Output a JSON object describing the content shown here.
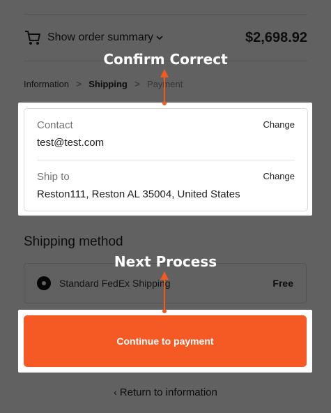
{
  "header": {
    "summary_label": "Show order summary",
    "total": "$2,698.92",
    "icons": {
      "cart": "cart-icon",
      "chevron": "chevron-down-icon"
    }
  },
  "breadcrumb": {
    "information": "Information",
    "shipping": "Shipping",
    "payment": "Payment",
    "separator": ">"
  },
  "review": {
    "contact_label": "Contact",
    "contact_value": "test@test.com",
    "contact_change": "Change",
    "shipto_label": "Ship to",
    "shipto_value": "Reston111, Reston AL 35004, United States",
    "shipto_change": "Change"
  },
  "shipping_method": {
    "title": "Shipping method",
    "option_name": "Standard FedEx Shipping",
    "option_price": "Free"
  },
  "actions": {
    "continue_label": "Continue to payment",
    "return_label": "Return to information",
    "return_icon": "chevron-left-icon"
  },
  "annotations": {
    "top_callout": "Confirm Correct",
    "bottom_callout": "Next Process"
  },
  "colors": {
    "accent": "#f55a24",
    "overlay": "rgba(0,0,0,0.62)"
  }
}
